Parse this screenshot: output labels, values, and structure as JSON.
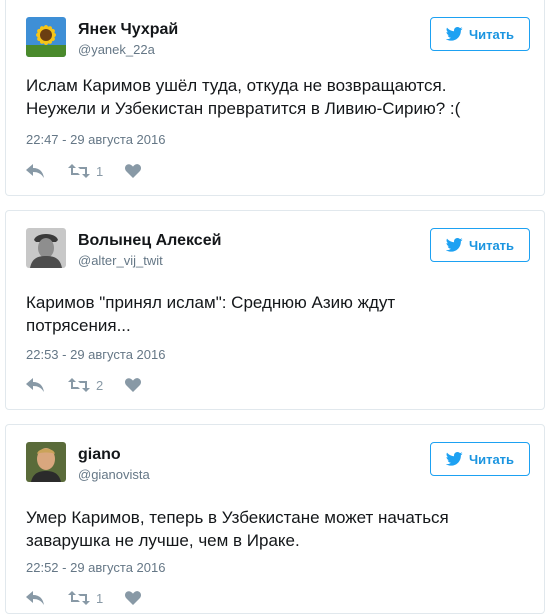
{
  "colors": {
    "accent": "#1da1f2",
    "text": "#14171a",
    "muted": "#657786",
    "icon": "#8899a6"
  },
  "tweets": [
    {
      "author": "Янек Чухрай",
      "handle": "@yanek_22a",
      "follow_label": "Читать",
      "text_lines": [
        "Ислам Каримов ушёл туда, откуда не возвращаются.",
        "Неужели и Узбекистан превратится в Ливию-Сирию? :("
      ],
      "timestamp": "22:47 - 29 августа 2016",
      "retweets": "1",
      "avatar": "sunflower-avatar"
    },
    {
      "author": "Волынец Алексей",
      "handle": "@alter_vij_twit",
      "follow_label": "Читать",
      "text_lines": [
        "Каримов \"принял ислам\": Среднюю Азию ждут",
        "потрясения..."
      ],
      "timestamp": "22:53 - 29 августа 2016",
      "retweets": "2",
      "avatar": "soldier-portrait-avatar"
    },
    {
      "author": "giano",
      "handle": "@gianovista",
      "follow_label": "Читать",
      "text_lines": [
        "Умер Каримов, теперь в Узбекистане может начаться",
        "заварушка не лучше, чем в Ираке."
      ],
      "timestamp": "22:52 - 29 августа 2016",
      "retweets": "1",
      "avatar": "man-photo-avatar"
    }
  ]
}
